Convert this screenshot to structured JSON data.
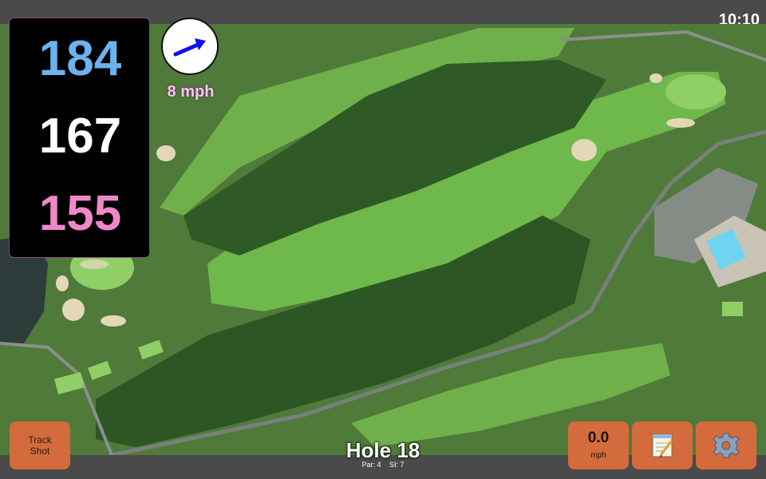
{
  "status_bar": {
    "time": "10:10"
  },
  "distances": {
    "back": "184",
    "middle": "167",
    "front": "155"
  },
  "wind": {
    "speed": "8 mph",
    "direction_icon": "wind-arrow-icon"
  },
  "hole": {
    "title": "Hole 18",
    "par": "Par: 4",
    "si": "SI: 7"
  },
  "buttons": {
    "track_shot": "Track\nShot",
    "speed_value": "0.0",
    "speed_unit": "mph",
    "notes_icon": "notepad-icon",
    "settings_icon": "gear-icon"
  },
  "colors": {
    "back_distance": "#6bb2ee",
    "middle_distance": "#ffffff",
    "front_distance": "#f088c8",
    "button_orange": "#d46b3c",
    "wind_arrow": "#1010ee"
  }
}
